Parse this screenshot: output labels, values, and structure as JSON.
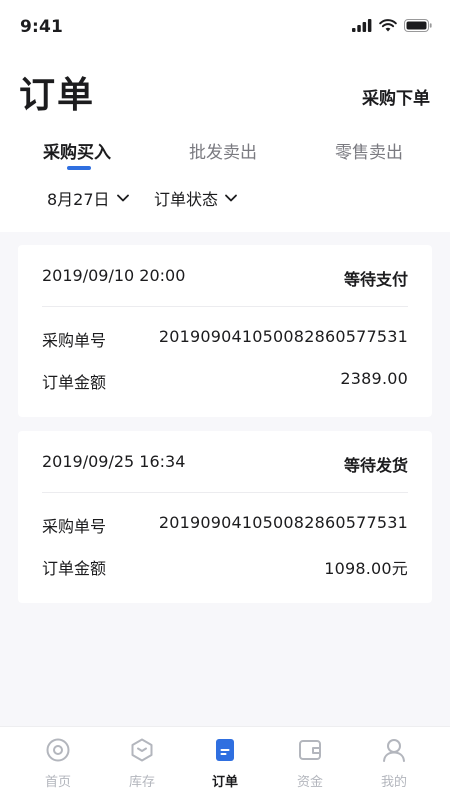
{
  "status_bar": {
    "time": "9:41"
  },
  "header": {
    "title": "订单",
    "action_label": "采购下单"
  },
  "tabs": [
    {
      "label": "采购买入",
      "active": true
    },
    {
      "label": "批发卖出",
      "active": false
    },
    {
      "label": "零售卖出",
      "active": false
    }
  ],
  "filters": {
    "date": "8月27日",
    "status": "订单状态"
  },
  "orders": [
    {
      "datetime": "2019/09/10 20:00",
      "status": "等待支付",
      "order_no_label": "采购单号",
      "order_no": "20190904105008286057753​1",
      "amount_label": "订单金额",
      "amount": "2389.00"
    },
    {
      "datetime": "2019/09/25 16:34",
      "status": "等待发货",
      "order_no_label": "采购单号",
      "order_no": "201909041050082860577531",
      "amount_label": "订单金额",
      "amount": "1098.00元"
    }
  ],
  "tabbar": [
    {
      "label": "首页",
      "icon": "home-icon",
      "active": false
    },
    {
      "label": "库存",
      "icon": "inventory-icon",
      "active": false
    },
    {
      "label": "订单",
      "icon": "orders-icon",
      "active": true
    },
    {
      "label": "资金",
      "icon": "wallet-icon",
      "active": false
    },
    {
      "label": "我的",
      "icon": "profile-icon",
      "active": false
    }
  ],
  "colors": {
    "accent": "#2f6fe0",
    "inactive": "#b3b6bd",
    "background": "#f7f7fa"
  }
}
